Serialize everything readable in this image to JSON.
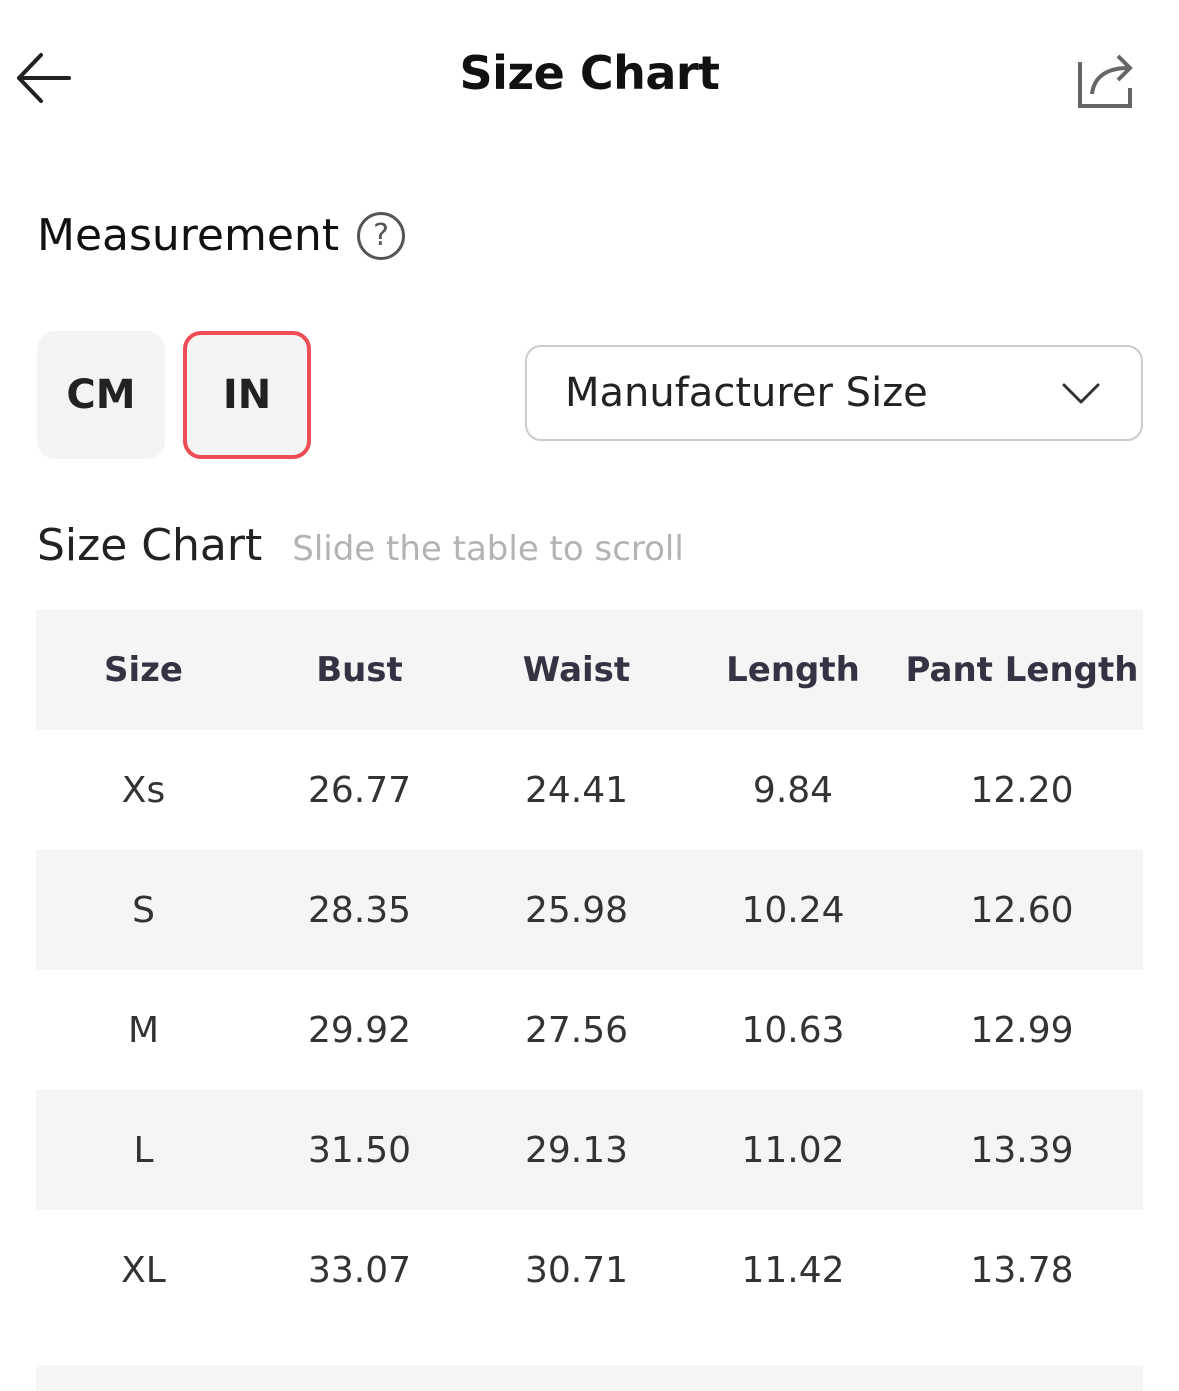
{
  "header": {
    "title": "Size Chart",
    "back_icon": "arrow-left-icon",
    "share_icon": "share-icon"
  },
  "measurement": {
    "label": "Measurement",
    "help_icon_glyph": "?"
  },
  "units": {
    "options": [
      "CM",
      "IN"
    ],
    "selected": "IN"
  },
  "size_select": {
    "value": "Manufacturer Size"
  },
  "size_chart": {
    "title": "Size Chart",
    "hint": "Slide the table to scroll",
    "columns": [
      "Size",
      "Bust",
      "Waist",
      "Length",
      "Pant Length"
    ],
    "rows": [
      [
        "Xs",
        "26.77",
        "24.41",
        "9.84",
        "12.20"
      ],
      [
        "S",
        "28.35",
        "25.98",
        "10.24",
        "12.60"
      ],
      [
        "M",
        "29.92",
        "27.56",
        "10.63",
        "12.99"
      ],
      [
        "L",
        "31.50",
        "29.13",
        "11.02",
        "13.39"
      ],
      [
        "XL",
        "33.07",
        "30.71",
        "11.42",
        "13.78"
      ]
    ]
  },
  "colors": {
    "accent_border": "#ee4d55",
    "row_shade": "#f5f5f5",
    "hint_text": "#b3b3b3"
  }
}
